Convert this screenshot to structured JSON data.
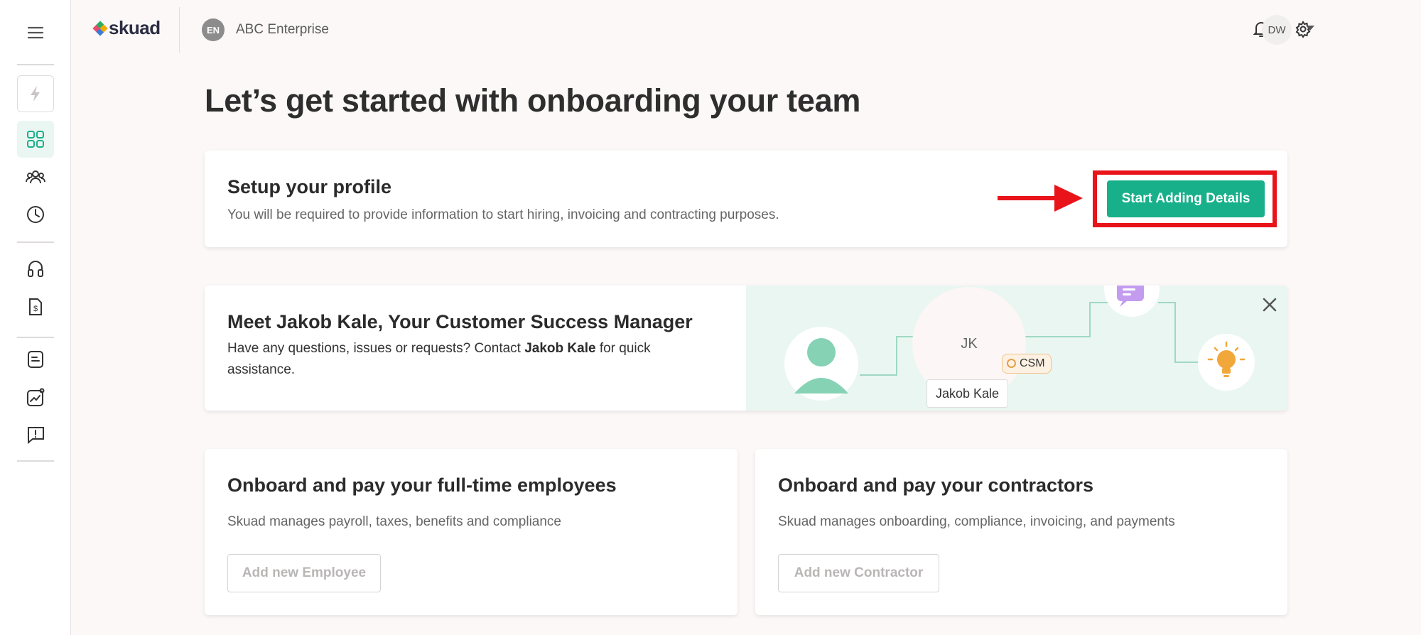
{
  "header": {
    "logo_text": "skuad",
    "org_badge": "EN",
    "org_name": "ABC Enterprise",
    "avatar_initials": "DW"
  },
  "page": {
    "title": "Let’s get started with onboarding your team"
  },
  "profile_card": {
    "title": "Setup your profile",
    "subtitle": "You will be required to provide information to start hiring, invoicing and contracting purposes.",
    "button_label": "Start Adding Details"
  },
  "csm_card": {
    "title": "Meet Jakob Kale, Your Customer Success Manager",
    "text_before": "Have any questions, issues or requests? Contact ",
    "text_name": "Jakob Kale",
    "text_after": " for quick assistance.",
    "avatar_initials": "JK",
    "badge": "CSM",
    "name_tag": "Jakob Kale"
  },
  "employees_card": {
    "title": "Onboard and pay your full-time employees",
    "subtitle": "Skuad manages payroll, taxes, benefits and compliance",
    "button_label": "Add new Employee"
  },
  "contractors_card": {
    "title": "Onboard and pay your contractors",
    "subtitle": "Skuad manages onboarding, compliance, invoicing, and payments",
    "button_label": "Add new Contractor"
  },
  "colors": {
    "accent": "#17b08a",
    "highlight": "#e8141a",
    "illustration_bg": "#eaf6f1"
  }
}
